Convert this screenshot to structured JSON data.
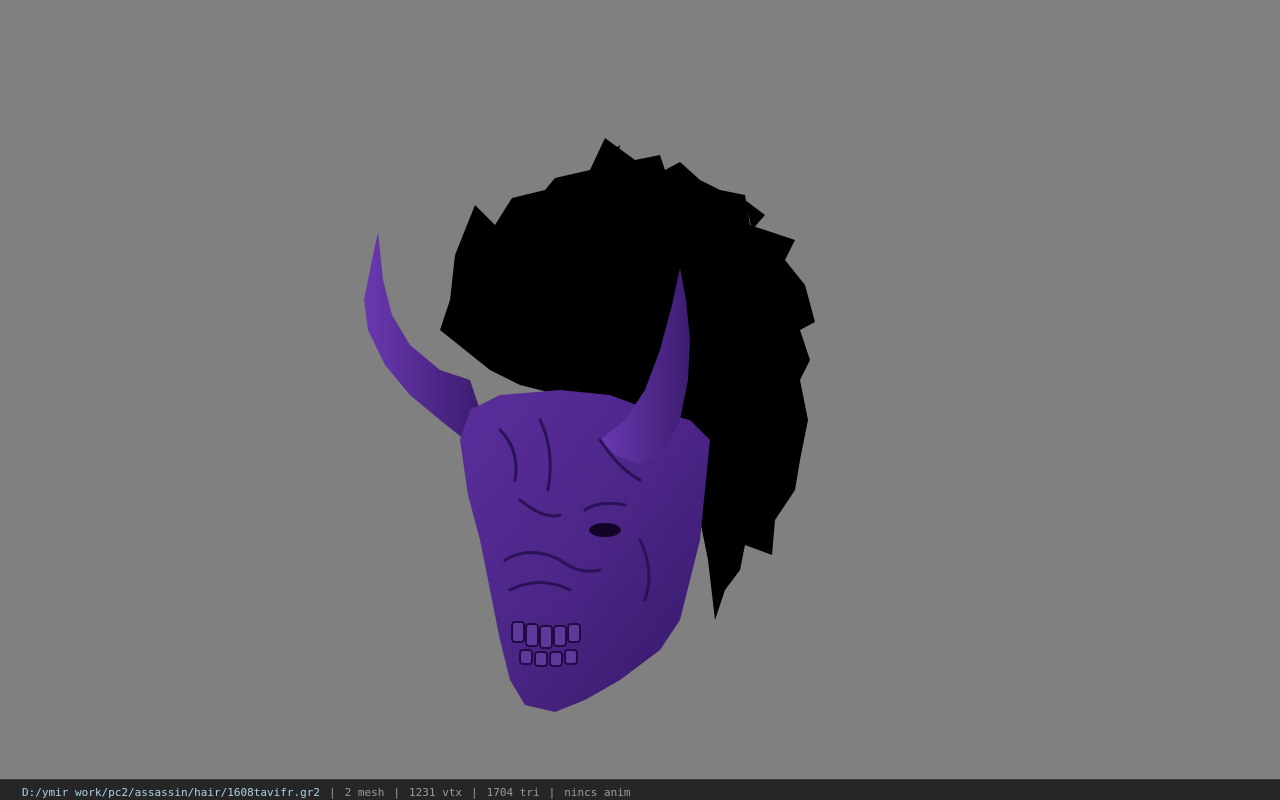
{
  "viewport": {
    "background": "#808080",
    "model": {
      "mask_color": "#4a2585",
      "mask_shadow": "#2f1660",
      "hair_color": "#000000"
    }
  },
  "status_bar": {
    "file_path": "D:/ymir work/pc2/assassin/hair/1608tavifr.gr2",
    "separator": "|",
    "mesh_count": "2 mesh",
    "vertex_count": "1231 vtx",
    "triangle_count": "1704 tri",
    "anim_status": "nincs anim"
  }
}
